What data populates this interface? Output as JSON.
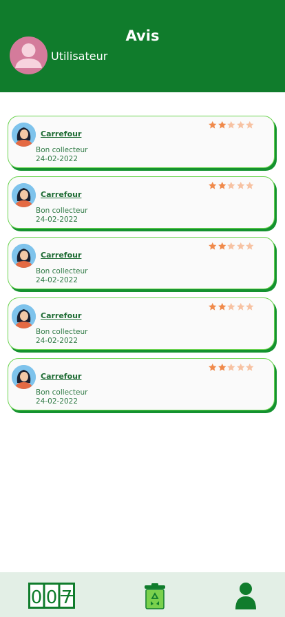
{
  "header": {
    "title": "Avis",
    "username": "Utilisateur"
  },
  "reviews": [
    {
      "name": "Carrefour",
      "comment": "Bon collecteur",
      "date": "24-02-2022",
      "rating": 2,
      "max_rating": 5
    },
    {
      "name": "Carrefour",
      "comment": "Bon collecteur",
      "date": "24-02-2022",
      "rating": 2,
      "max_rating": 5
    },
    {
      "name": "Carrefour",
      "comment": "Bon collecteur",
      "date": "24-02-2022",
      "rating": 2,
      "max_rating": 5
    },
    {
      "name": "Carrefour",
      "comment": "Bon collecteur",
      "date": "24-02-2022",
      "rating": 2,
      "max_rating": 5
    },
    {
      "name": "Carrefour",
      "comment": "Bon collecteur",
      "date": "24-02-2022",
      "rating": 2,
      "max_rating": 5
    }
  ],
  "bottom_nav": {
    "counter_digits": [
      "0",
      "0",
      "7"
    ],
    "items": [
      {
        "icon": "counter-icon"
      },
      {
        "icon": "recycle-bin-icon"
      },
      {
        "icon": "person-icon"
      }
    ]
  },
  "colors": {
    "header_bg": "#107c2c",
    "card_border": "#6bd44f",
    "card_shadow": "#14922f",
    "star_filled": "#f08a4b",
    "star_empty": "#f7c2a2",
    "nav_bg": "#e3efe6"
  }
}
